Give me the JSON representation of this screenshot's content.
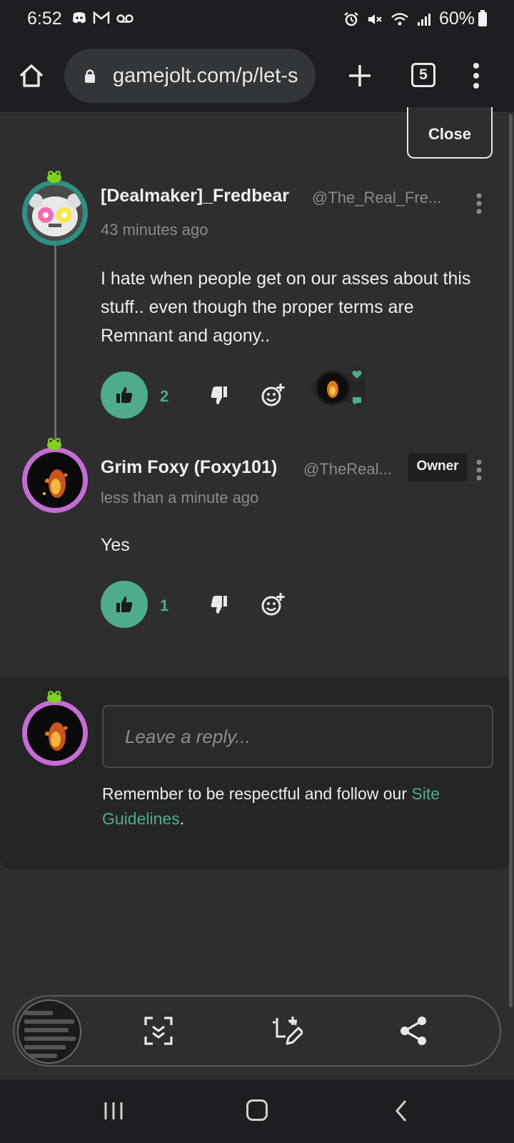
{
  "status_bar": {
    "time": "6:52",
    "battery": "60%"
  },
  "browser": {
    "url": "gamejolt.com/p/let-s",
    "tab_count": "5"
  },
  "close_label": "Close",
  "comments": [
    {
      "username": "[Dealmaker]_Fredbear",
      "handle": "@The_Real_Fre...",
      "time": "43 minutes ago",
      "text": "I hate when people get on our asses about this stuff.. even though the proper terms are Remnant and agony..",
      "likes": "2"
    },
    {
      "username": "Grim Foxy (Foxy101)",
      "handle": "@TheReal...",
      "badge": "Owner",
      "time": "less than a minute ago",
      "text": "Yes",
      "likes": "1"
    }
  ],
  "reply": {
    "placeholder": "Leave a reply...",
    "guidelines_prefix": "Remember to be respectful and follow our ",
    "guidelines_link": "Site Guidelines",
    "guidelines_suffix": "."
  },
  "colors": {
    "accent": "#4eac8a",
    "background": "#2e2e2e",
    "reply_bg": "#252525",
    "avatar_ring_1": "#2f8f83",
    "avatar_ring_2": "#c56bd6"
  },
  "icons": {
    "status_left": [
      "discord-icon",
      "gmail-icon",
      "voicemail-icon"
    ],
    "status_right": [
      "alarm-icon",
      "mute-icon",
      "wifi-icon",
      "signal-icon",
      "battery-icon"
    ],
    "action_bar": [
      "scan-icon",
      "edit-capture-icon",
      "share-icon"
    ]
  }
}
